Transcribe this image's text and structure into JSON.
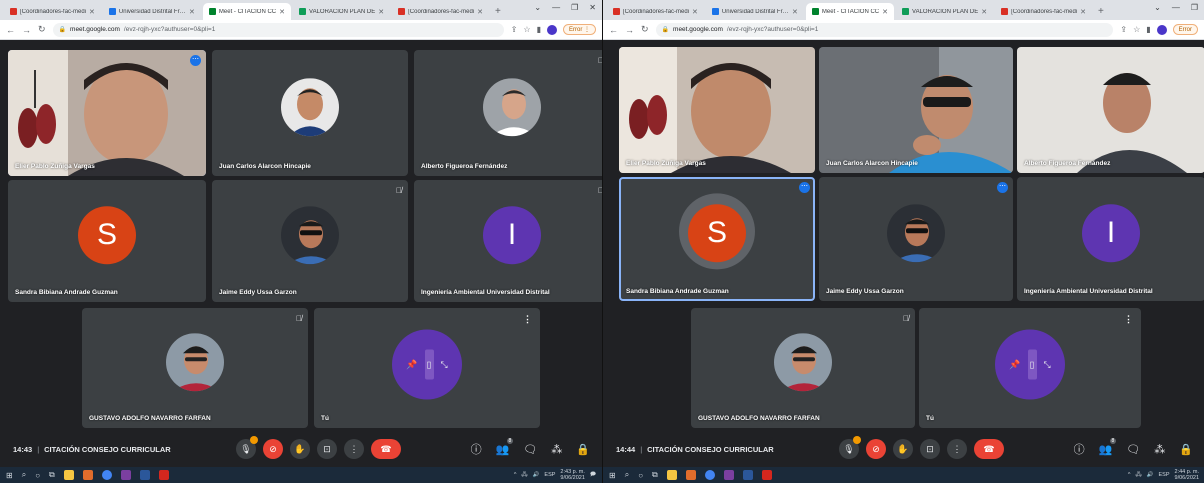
{
  "screens": [
    {
      "tabs": [
        {
          "label": "[Coordinadores-fac-medi",
          "fav_color": "#d93025"
        },
        {
          "label": "Universidad Distrital Franc",
          "fav_color": "#1a73e8"
        },
        {
          "label": "Meet - CITACIÓN CC",
          "fav_color": "#00832d",
          "active": true
        },
        {
          "label": "VALORACION PLAN DE",
          "fav_color": "#0f9d58"
        },
        {
          "label": "[Coordinadores-fac-medi",
          "fav_color": "#d93025"
        }
      ],
      "url_host": "meet.google.com",
      "url_path": "/evz-rqjh-yxc?authuser=0&pli=1",
      "error_label": "Error",
      "participants": [
        {
          "name": "Elier Pablo Zuñiga Vargas",
          "type": "video"
        },
        {
          "name": "Juan Carlos Alarcon Hincapie",
          "type": "photo"
        },
        {
          "name": "Alberto Figueroa Fernández",
          "type": "photo"
        },
        {
          "name": "Sandra Bibiana Andrade Guzman",
          "type": "letter",
          "letter": "S",
          "color": "#d84315"
        },
        {
          "name": "Jaime Eddy Ussa Garzon",
          "type": "photo"
        },
        {
          "name": "Ingeniería Ambiental Universidad Distrital",
          "type": "letter",
          "letter": "I",
          "color": "#5e35b1"
        },
        {
          "name": "GUSTAVO ADOLFO NAVARRO FARFAN",
          "type": "photo"
        },
        {
          "name": "Tú",
          "type": "self"
        }
      ],
      "time": "14:43",
      "meeting_title": "CITACIÓN CONSEJO CURRICULAR",
      "people_count": "8",
      "tray_lang": "ESP",
      "tray_time": "2:43 p. m.",
      "tray_date": "9/06/2021"
    },
    {
      "tabs": [
        {
          "label": "[Coordinadores-fac-medi",
          "fav_color": "#d93025"
        },
        {
          "label": "Universidad Distrital Franc",
          "fav_color": "#1a73e8"
        },
        {
          "label": "Meet - CITACIÓN CC",
          "fav_color": "#00832d",
          "active": true
        },
        {
          "label": "VALORACION PLAN DE",
          "fav_color": "#0f9d58"
        },
        {
          "label": "[Coordinadores-fac-medi",
          "fav_color": "#d93025"
        }
      ],
      "url_host": "meet.google.com",
      "url_path": "/evz-rqjh-yxc?authuser=0&pli=1",
      "error_label": "Error",
      "participants": [
        {
          "name": "Elier Pablo Zuñiga Vargas",
          "type": "video"
        },
        {
          "name": "Juan Carlos Alarcon Hincapie",
          "type": "video"
        },
        {
          "name": "Alberto Figueroa Fernández",
          "type": "video"
        },
        {
          "name": "Sandra Bibiana Andrade Guzman",
          "type": "letter",
          "letter": "S",
          "color": "#d84315"
        },
        {
          "name": "Jaime Eddy Ussa Garzon",
          "type": "photo"
        },
        {
          "name": "Ingeniería Ambiental Universidad Distrital",
          "type": "letter",
          "letter": "I",
          "color": "#5e35b1"
        },
        {
          "name": "GUSTAVO ADOLFO NAVARRO FARFAN",
          "type": "photo"
        },
        {
          "name": "Tú",
          "type": "self"
        }
      ],
      "time": "14:44",
      "meeting_title": "CITACIÓN CONSEJO CURRICULAR",
      "people_count": "8",
      "tray_lang": "ESP",
      "tray_time": "2:44 p. m.",
      "tray_date": "9/06/2021"
    }
  ]
}
